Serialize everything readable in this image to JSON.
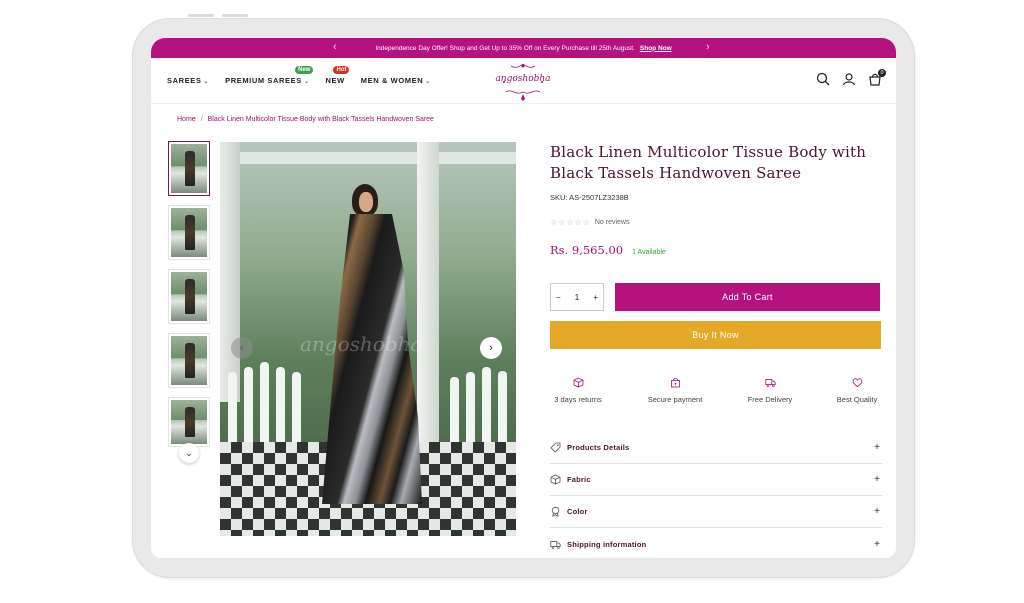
{
  "announcement": {
    "text": "Independence Day Offer! Shop and Get Up to 35% Off on Every Purchase till 25th August.",
    "link": "Shop Now",
    "prev_arrow": "‹",
    "next_arrow": "›"
  },
  "nav": {
    "items": [
      {
        "label": "SAREES"
      },
      {
        "label": "PREMIUM SAREES",
        "badge": "New"
      },
      {
        "label": "NEW",
        "badge": "Hot"
      },
      {
        "label": "MEN & WOMEN"
      }
    ]
  },
  "brand": {
    "logo_text": "angoshobha",
    "accent": "#b5117f"
  },
  "header_icons": {
    "search": "search-icon",
    "account": "user-icon",
    "cart": "cart-icon",
    "cart_count": "0"
  },
  "breadcrumb": {
    "home": "Home",
    "separator": "/",
    "current": "Black Linen Multicolor Tissue Body with Black Tassels Handwoven Saree"
  },
  "gallery": {
    "watermark": "angoshobha",
    "thumbnails": [
      "thumb-1",
      "thumb-2",
      "thumb-3",
      "thumb-4",
      "thumb-5"
    ],
    "active_index": 0
  },
  "product": {
    "title": "Black Linen Multicolor Tissue Body with Black Tassels Handwoven Saree",
    "sku": "SKU: AS-2507LZ3238B",
    "stars": "☆☆☆☆☆",
    "reviews": "No reviews",
    "price": "Rs. 9,565.00",
    "availability": "1 Available",
    "quantity": "1",
    "add_to_cart": "Add To Cart",
    "buy_now": "Buy It Now"
  },
  "features": [
    {
      "icon": "box-icon",
      "label": "3 days returns"
    },
    {
      "icon": "lock-bag-icon",
      "label": "Secure payment"
    },
    {
      "icon": "truck-icon",
      "label": "Free Delivery"
    },
    {
      "icon": "heart-icon",
      "label": "Best Quality"
    }
  ],
  "accordion": [
    {
      "icon": "tag-icon",
      "label": "Products Details"
    },
    {
      "icon": "box-icon",
      "label": "Fabric"
    },
    {
      "icon": "badge-icon",
      "label": "Color"
    },
    {
      "icon": "truck-icon",
      "label": "Shipping information"
    }
  ],
  "colors": {
    "primary": "#b5117f",
    "buy_now": "#e5a927",
    "title": "#4a1434",
    "available": "#3a9b3f"
  }
}
